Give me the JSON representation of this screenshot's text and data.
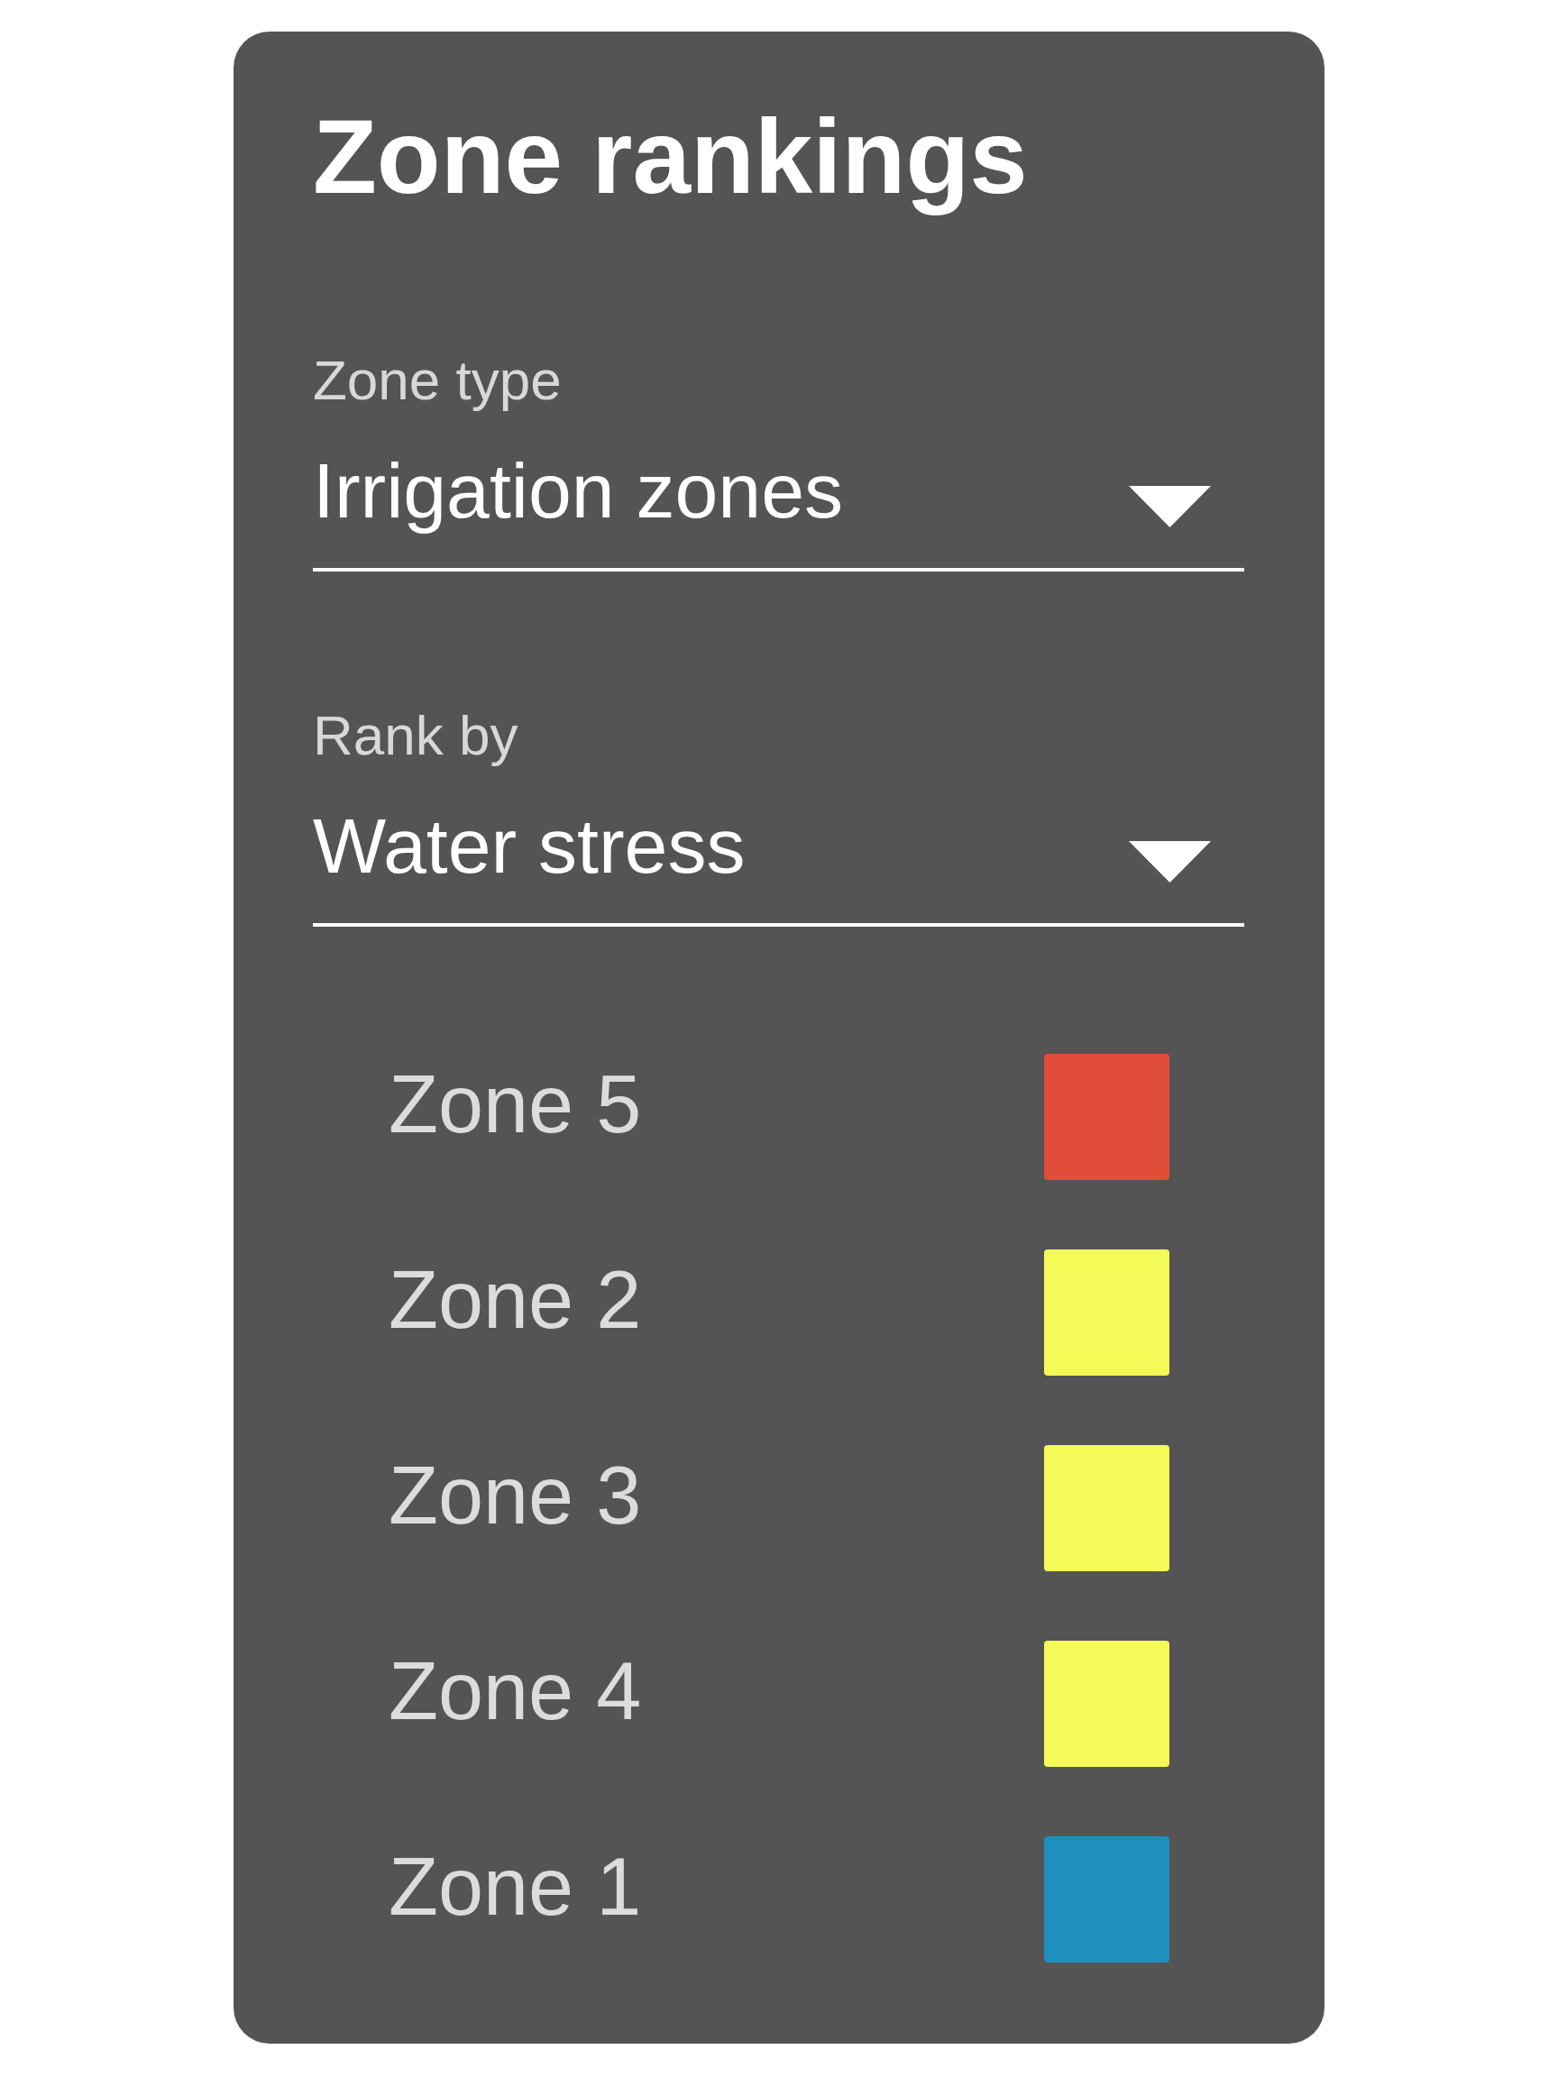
{
  "title": "Zone rankings",
  "filters": [
    {
      "label": "Zone type",
      "value": "Irrigation zones"
    },
    {
      "label": "Rank by",
      "value": "Water stress"
    }
  ],
  "zones": [
    {
      "name": "Zone 5",
      "color": "#e04e39"
    },
    {
      "name": "Zone 2",
      "color": "#f4fa58"
    },
    {
      "name": "Zone 3",
      "color": "#f4fa58"
    },
    {
      "name": "Zone 4",
      "color": "#f4fa58"
    },
    {
      "name": "Zone 1",
      "color": "#1e8fbe"
    }
  ]
}
